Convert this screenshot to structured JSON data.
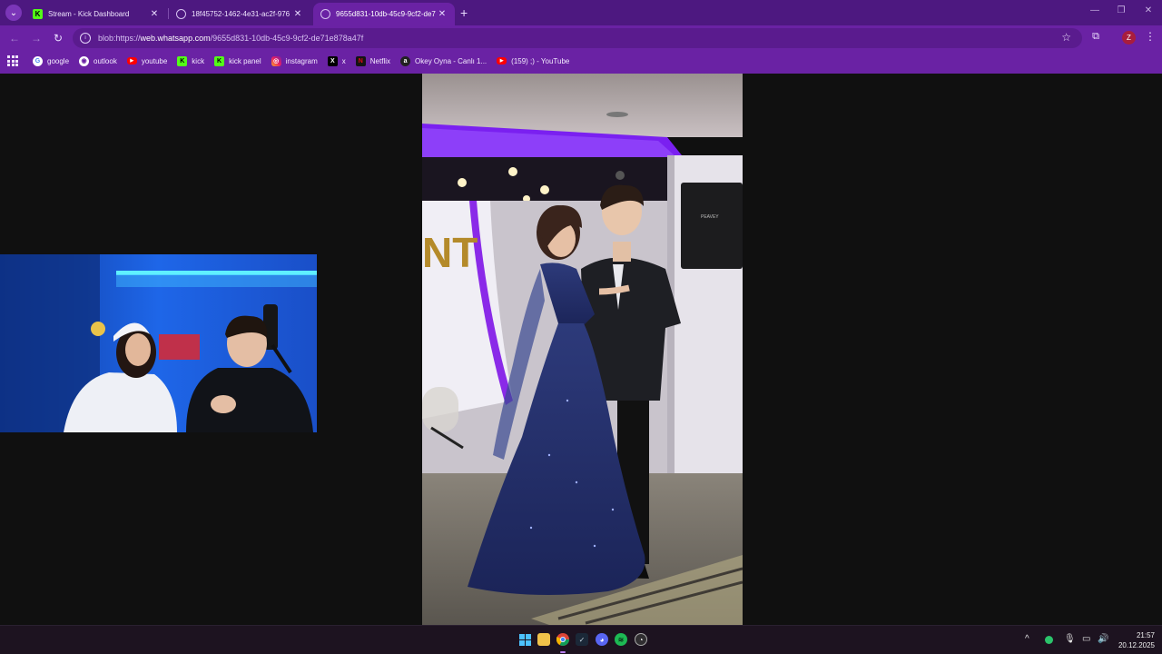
{
  "browser": {
    "tabs": [
      {
        "title": "Stream - Kick Dashboard",
        "icon": "kick-icon",
        "active": false
      },
      {
        "title": "18f45752-1462-4e31-ac2f-976",
        "icon": "globe-icon",
        "active": false
      },
      {
        "title": "9655d831-10db-45c9-9cf2-de7",
        "icon": "globe-icon",
        "active": true
      }
    ],
    "new_tab": "+",
    "url_prefix": "blob:https://",
    "url_host": "web.whatsapp.com",
    "url_path": "/9655d831-10db-45c9-9cf2-de71e878a47f",
    "profile_initial": "Z",
    "accent": "#6a22a4"
  },
  "bookmarks": [
    {
      "label": "google",
      "icon": "google-icon"
    },
    {
      "label": "outlook",
      "icon": "outlook-icon"
    },
    {
      "label": "youtube",
      "icon": "youtube-icon"
    },
    {
      "label": "kick",
      "icon": "kick-icon"
    },
    {
      "label": "kick panel",
      "icon": "kick-icon"
    },
    {
      "label": "instagram",
      "icon": "instagram-icon"
    },
    {
      "label": "x",
      "icon": "x-icon"
    },
    {
      "label": "Netflix",
      "icon": "netflix-icon"
    },
    {
      "label": "Okey Oyna - Canlı 1...",
      "icon": "okey-icon"
    },
    {
      "label": "(159) ;) - YouTube",
      "icon": "youtube-icon"
    }
  ],
  "photo": {
    "signage": "NT",
    "speaker_brand": "PEAVEY"
  },
  "taskbar": {
    "apps": [
      "windows-start-icon",
      "file-explorer-icon",
      "chrome-icon",
      "steam-icon",
      "discord-icon",
      "spotify-icon",
      "obs-icon"
    ],
    "time": "21:57",
    "date": "20.12.2025"
  }
}
